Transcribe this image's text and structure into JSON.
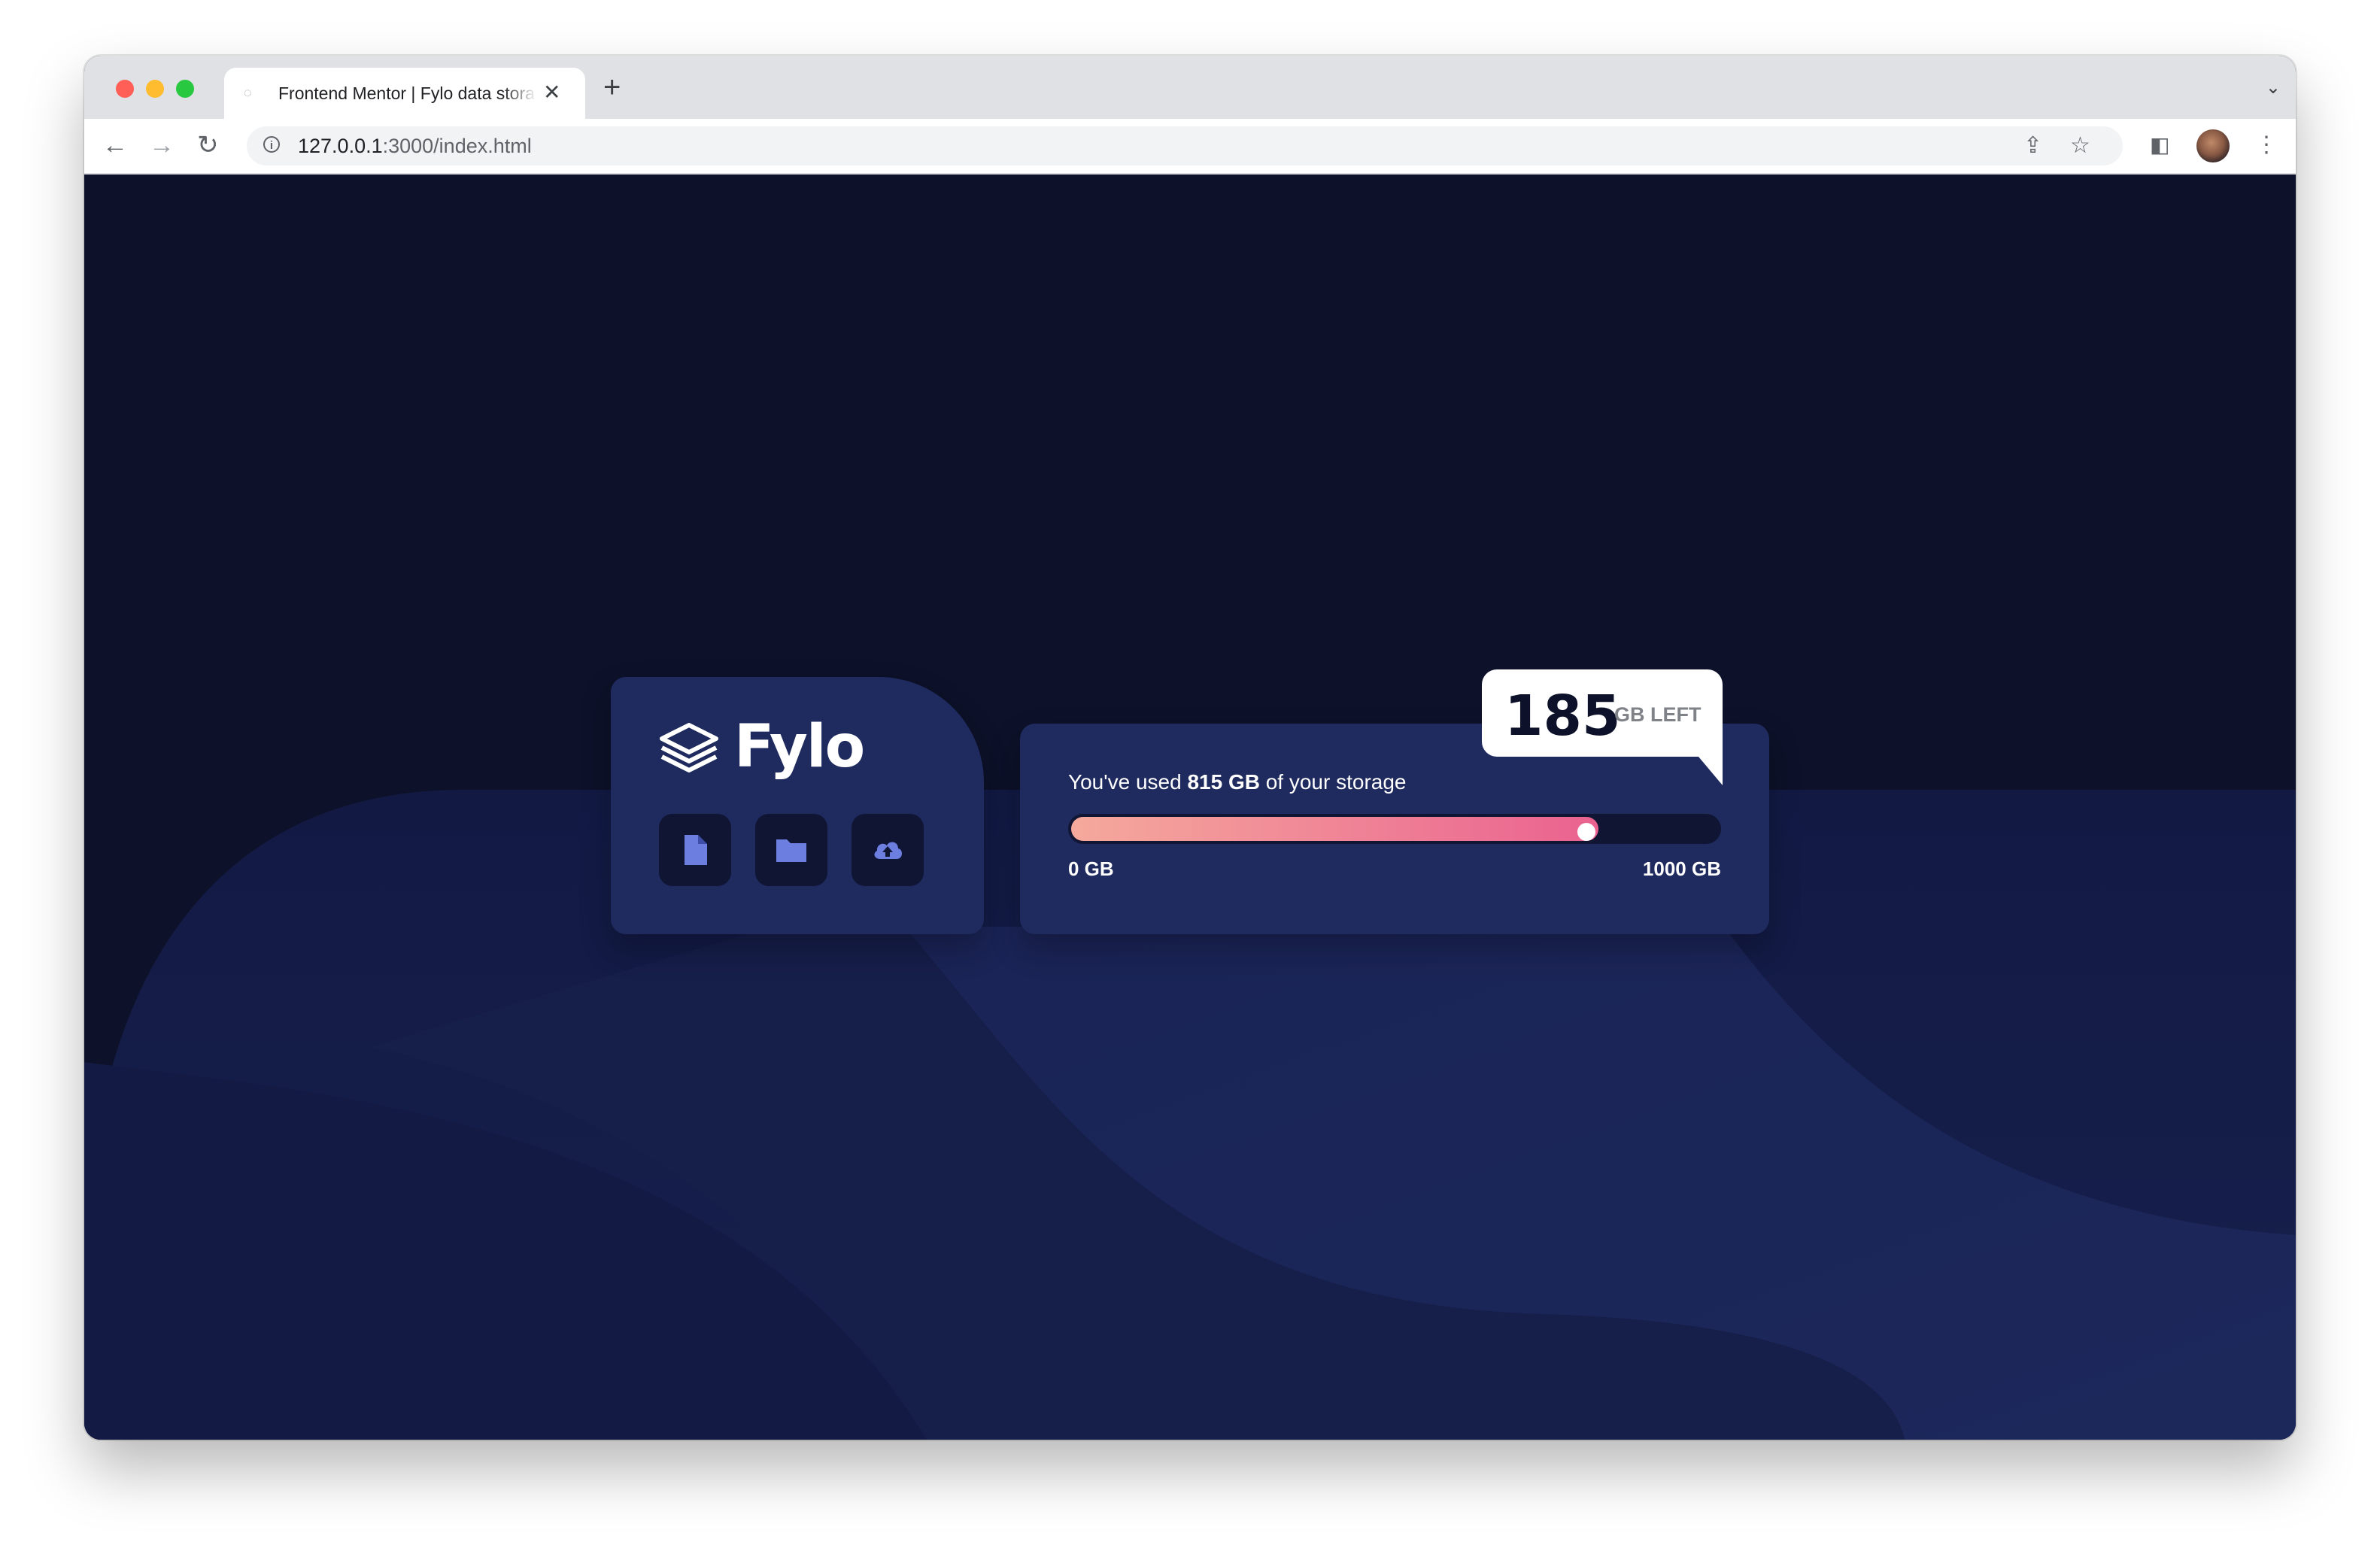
{
  "browser": {
    "tab_title": "Frontend Mentor | Fylo data storage component",
    "url_host": "127.0.0.1",
    "url_rest": ":3000/index.html"
  },
  "app": {
    "logo_text": "Fylo",
    "icon_buttons": [
      "document-icon",
      "folder-icon",
      "upload-icon"
    ]
  },
  "storage": {
    "usage_prefix": "You've used ",
    "used_amount": "815 GB",
    "usage_suffix": " of your storage",
    "remaining_number": "185",
    "remaining_unit": "GB LEFT",
    "scale_min": "0 GB",
    "scale_max": "1000 GB",
    "used_fraction": 0.815
  },
  "colors": {
    "background": "#0d1129",
    "card": "#1f2a5e",
    "gradient_start": "#f5a99c",
    "gradient_end": "#ea6290",
    "icon_accent": "#6c7ee0"
  }
}
